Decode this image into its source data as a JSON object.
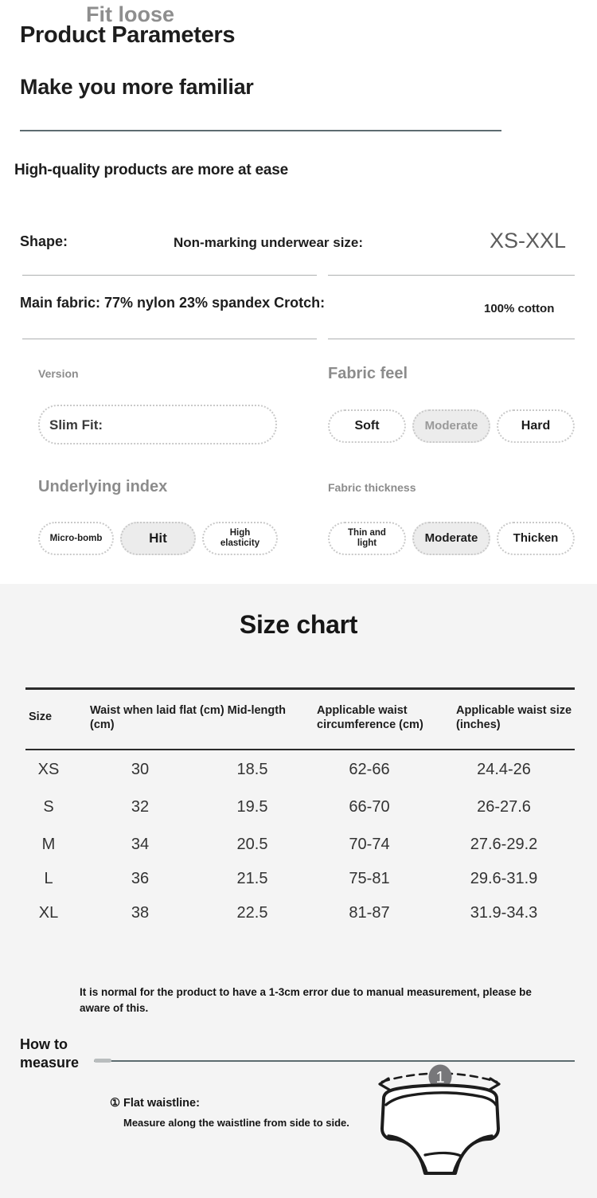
{
  "header": {
    "title": "Product Parameters",
    "subtitle": "Make you more familiar",
    "tagline": "High-quality products are more at ease"
  },
  "specs": [
    {
      "key_label": "Shape:",
      "mid_label": "Non-marking underwear size:",
      "value": "XS-XXL"
    },
    {
      "key_label": "Main fabric: 77% nylon 23% spandex Crotch:",
      "value": "100% cotton"
    }
  ],
  "attributes": [
    {
      "heading": "Version",
      "type": "keyvalue",
      "key": "Slim Fit:",
      "value": "Fit loose"
    },
    {
      "heading": "Fabric feel",
      "type": "options",
      "options": [
        {
          "label": "Soft",
          "selected": false
        },
        {
          "label": "Moderate",
          "selected": true
        },
        {
          "label": "Hard",
          "selected": false
        }
      ]
    },
    {
      "heading": "Underlying index",
      "type": "options",
      "options": [
        {
          "label": "Micro-bomb",
          "selected": false
        },
        {
          "label": "Hit",
          "selected": true
        },
        {
          "label": "High\nelasticity",
          "selected": false
        }
      ]
    },
    {
      "heading": "Fabric thickness",
      "type": "options",
      "options": [
        {
          "label": "Thin and\nlight",
          "selected": false
        },
        {
          "label": "Moderate",
          "selected": true
        },
        {
          "label": "Thicken",
          "selected": false
        }
      ]
    }
  ],
  "size_chart": {
    "title": "Size chart",
    "columns": [
      "Size",
      "Waist when laid flat (cm) Mid-length (cm)",
      "Applicable waist circumference (cm)",
      "Applicable waist size (inches)"
    ],
    "rows": [
      {
        "size": "XS",
        "waist_flat": "30",
        "mid_length": "18.5",
        "waist_circ": "62-66",
        "waist_inches": "24.4-26"
      },
      {
        "size": "S",
        "waist_flat": "32",
        "mid_length": "19.5",
        "waist_circ": "66-70",
        "waist_inches": "26-27.6"
      },
      {
        "size": "M",
        "waist_flat": "34",
        "mid_length": "20.5",
        "waist_circ": "70-74",
        "waist_inches": "27.6-29.2"
      },
      {
        "size": "L",
        "waist_flat": "36",
        "mid_length": "21.5",
        "waist_circ": "75-81",
        "waist_inches": "29.6-31.9"
      },
      {
        "size": "XL",
        "waist_flat": "38",
        "mid_length": "22.5",
        "waist_circ": "81-87",
        "waist_inches": "31.9-34.3"
      }
    ],
    "note": "It is normal for the product to have a 1-3cm error due to manual measurement, please be aware of this."
  },
  "how_to_measure": {
    "label": "How to measure",
    "step_title": "① Flat waistline:",
    "step_desc": "Measure along the waistline from side to side.",
    "marker": "1"
  },
  "colors": {
    "page_bg": "#ffffff",
    "panel_bg": "#f4f4f4",
    "hero_rule": "#5d6c70",
    "spec_rule": "#aeb0b1",
    "table_rule": "#2b2b2b",
    "pill_border": "#c9c9c9",
    "pill_selected_bg": "#ececec",
    "muted_text": "#8c8c8c",
    "marker_bg": "#77777a"
  }
}
